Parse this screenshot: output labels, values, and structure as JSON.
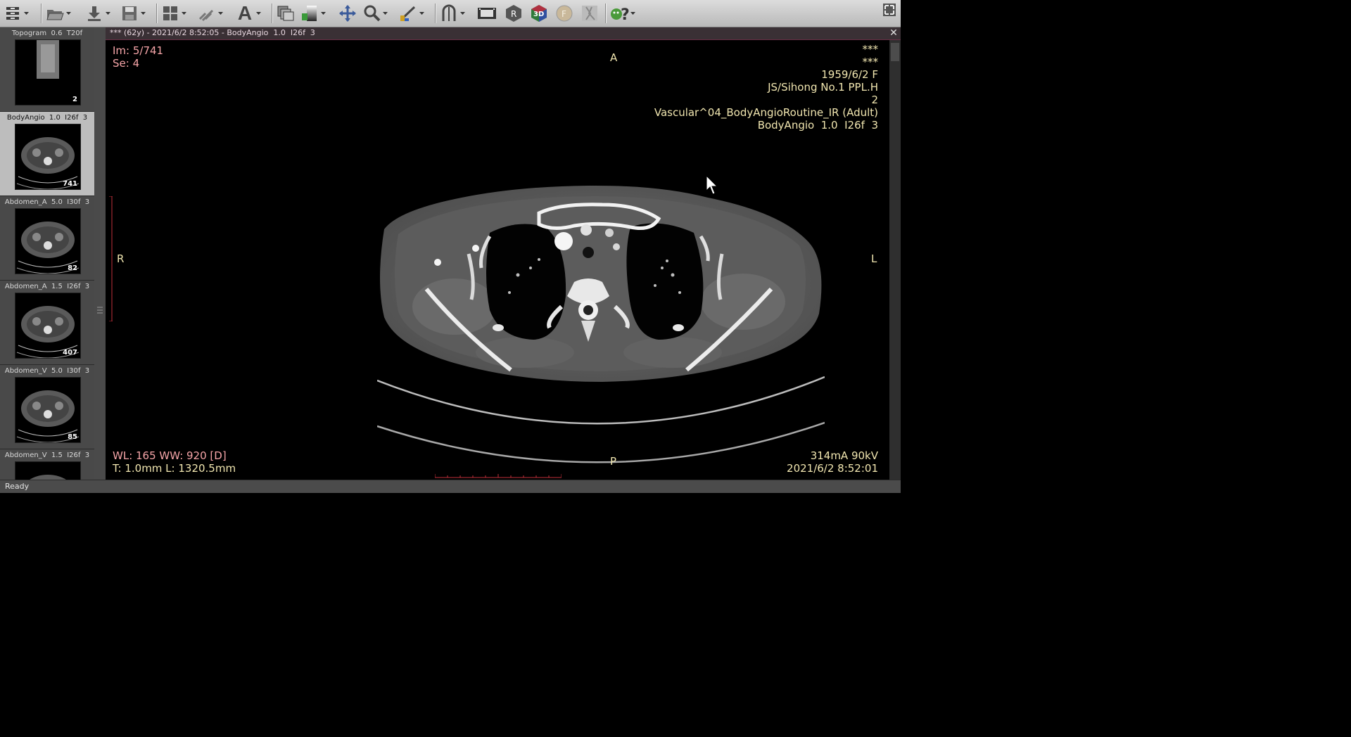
{
  "toolbar": {
    "buttons": [
      {
        "icon": "patient-browser-icon"
      },
      {
        "icon": "open-folder-icon"
      },
      {
        "icon": "download-icon"
      },
      {
        "icon": "save-icon"
      },
      {
        "icon": "layout-grid-icon"
      },
      {
        "icon": "link-icon"
      },
      {
        "icon": "text-annotation-icon"
      },
      {
        "icon": "stack-images-icon"
      },
      {
        "icon": "window-level-icon"
      },
      {
        "icon": "pan-icon"
      },
      {
        "icon": "zoom-icon"
      },
      {
        "icon": "measure-icon"
      },
      {
        "icon": "mpr-icon"
      },
      {
        "icon": "film-icon"
      },
      {
        "icon": "reconstruction-icon"
      },
      {
        "icon": "3d-icon"
      },
      {
        "icon": "fusion-icon"
      },
      {
        "icon": "vessel-icon"
      },
      {
        "icon": "help-icon"
      }
    ],
    "text_glyph": "A",
    "threed_label": "3D",
    "recon_label": "R",
    "fusion_label": "F",
    "help_glyph": "?"
  },
  "thumbnails": [
    {
      "label": "Topogram  0.6  T20f",
      "count": "2",
      "selected": false
    },
    {
      "label": "BodyAngio  1.0  I26f  3",
      "count": "741",
      "selected": true
    },
    {
      "label": "Abdomen_A  5.0  I30f  3",
      "count": "82",
      "selected": false
    },
    {
      "label": "Abdomen_A  1.5  I26f  3",
      "count": "407",
      "selected": false
    },
    {
      "label": "Abdomen_V  5.0  I30f  3",
      "count": "85",
      "selected": false
    },
    {
      "label": "Abdomen_V  1.5  I26f  3",
      "count": "",
      "selected": false
    }
  ],
  "viewer": {
    "title": "*** (62y) - 2021/6/2 8:52:05 - BodyAngio  1.0  I26f  3",
    "close_glyph": "✕",
    "top_left": {
      "image": "Im: 5/741",
      "series": "Se: 4"
    },
    "orientation": {
      "top": "A",
      "bottom": "P",
      "left": "R",
      "right": "L"
    },
    "top_right": [
      "***",
      "***",
      "1959/6/2 F",
      "JS/Sihong No.1 PPL.H",
      "2",
      "Vascular^04_BodyAngioRoutine_IR (Adult)",
      "BodyAngio  1.0  I26f  3"
    ],
    "bottom_left": {
      "window": "WL: 165 WW: 920 [D]",
      "thickness": "T: 1.0mm L: 1320.5mm"
    },
    "bottom_right": {
      "exposure": "314mA 90kV",
      "datetime": "2021/6/2 8:52:01"
    }
  },
  "status": {
    "text": "Ready"
  },
  "colors": {
    "overlay_pink": "#f6a5a8",
    "overlay_yellow": "#f1e6b0",
    "title_bar": "#3a3035",
    "ruler_red": "#c0303a"
  }
}
